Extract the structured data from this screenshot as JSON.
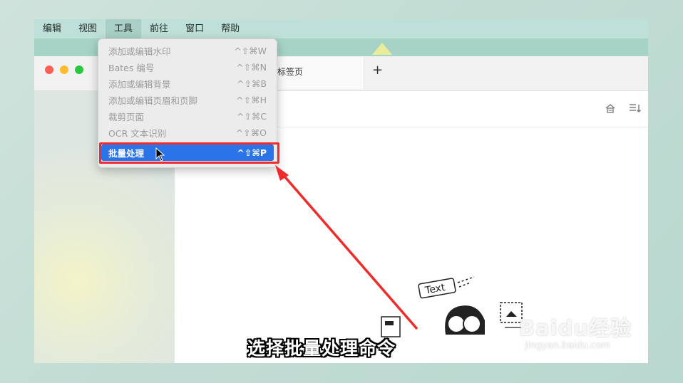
{
  "menubar": {
    "items": [
      {
        "label": "编辑"
      },
      {
        "label": "视图"
      },
      {
        "label": "工具"
      },
      {
        "label": "前往"
      },
      {
        "label": "窗口"
      },
      {
        "label": "帮助"
      }
    ],
    "active_index": 2
  },
  "tools_menu": {
    "items": [
      {
        "label": "添加或编辑水印",
        "shortcut": "^⇧⌘W",
        "enabled": false
      },
      {
        "label": "Bates 编号",
        "shortcut": "^⇧⌘N",
        "enabled": false
      },
      {
        "label": "添加或编辑背景",
        "shortcut": "^⇧⌘B",
        "enabled": false
      },
      {
        "label": "添加或编辑页眉和页脚",
        "shortcut": "^⇧⌘H",
        "enabled": false
      },
      {
        "label": "裁剪页面",
        "shortcut": "^⇧⌘C",
        "enabled": false
      },
      {
        "label": "OCR 文本识别",
        "shortcut": "^⇧⌘O",
        "enabled": false
      },
      {
        "label": "批量处理",
        "shortcut": "^⇧⌘P",
        "enabled": true,
        "selected": true
      }
    ]
  },
  "window": {
    "tab_label": "标签页",
    "new_tab_icon": "plus-icon",
    "traffic_lights": {
      "close": "#ff5f57",
      "minimize": "#febc2e",
      "zoom": "#28c840"
    }
  },
  "illustration": {
    "text_tag": "Text"
  },
  "caption": "选择批量处理命令",
  "watermark": {
    "logo": "Baidu经验",
    "sub": "jingyan.baidu.com"
  },
  "colors": {
    "highlight": "#2a73e8",
    "annotation": "#ef2b2b"
  }
}
